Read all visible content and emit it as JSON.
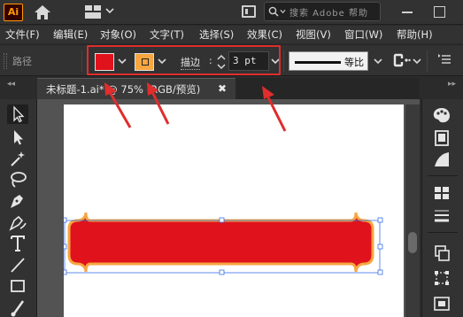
{
  "app": {
    "logo_text": "Ai"
  },
  "search": {
    "placeholder": "搜索 Adobe 帮助"
  },
  "menu": [
    {
      "label": "文件(F)"
    },
    {
      "label": "编辑(E)"
    },
    {
      "label": "对象(O)"
    },
    {
      "label": "文字(T)"
    },
    {
      "label": "选择(S)"
    },
    {
      "label": "效果(C)"
    },
    {
      "label": "视图(V)"
    },
    {
      "label": "窗口(W)"
    },
    {
      "label": "帮助(H)"
    }
  ],
  "control_bar": {
    "selection_type": "路径",
    "fill_color": "#e0121c",
    "stroke_color": "#f7a640",
    "stroke_label": "描边",
    "stroke_colon": ":",
    "stroke_weight": "3 pt",
    "profile_label": "等比"
  },
  "document_tab": {
    "title": "未标题-1.ai* @ 75% (RGB/预览)",
    "close_glyph": "✖"
  },
  "panel_collapse": {
    "left": "◂◂",
    "right": "▸▸"
  },
  "artwork": {
    "shape_fill": "#e0121c",
    "shape_stroke": "#f7a640",
    "selection_color": "#3a6fe8"
  },
  "annotation": {
    "color": "#e02d2d"
  }
}
